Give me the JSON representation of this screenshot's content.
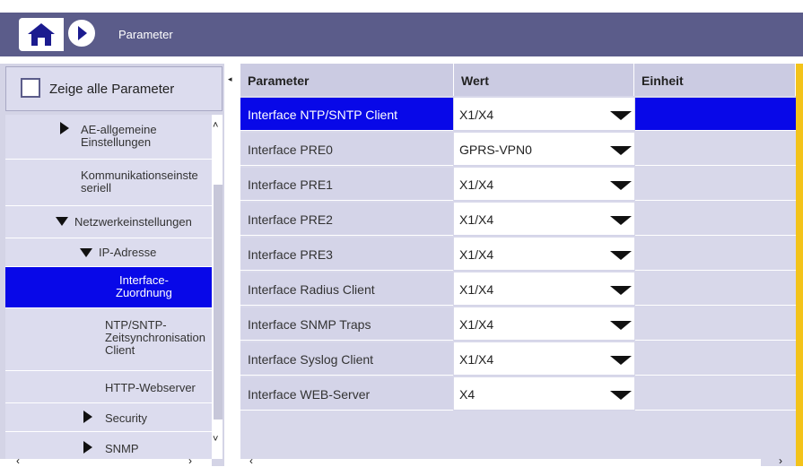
{
  "header": {
    "title": "Parameter",
    "home_icon": "home-icon",
    "forward_icon": "play-icon"
  },
  "left_panel": {
    "show_all_label": "Zeige alle Parameter",
    "show_all_checked": false,
    "tree": [
      {
        "label_lines": [
          "AE-allgemeine",
          "Einstellungen"
        ],
        "icon": "triangle-right-icon"
      },
      {
        "label_lines": [
          "Kommunikationseinste",
          "seriell"
        ],
        "icon": ""
      },
      {
        "label_lines": [
          "Netzwerkeinstellungen"
        ],
        "icon": "triangle-down-icon"
      },
      {
        "label_lines": [
          "IP-Adresse"
        ],
        "icon": "triangle-down-icon"
      },
      {
        "label_lines": [
          "Interface-",
          "Zuordnung"
        ],
        "icon": "",
        "active": true
      },
      {
        "label_lines": [
          "NTP/SNTP-",
          "Zeitsynchronisation",
          "Client"
        ],
        "icon": ""
      },
      {
        "label_lines": [
          "HTTP-Webserver"
        ],
        "icon": ""
      },
      {
        "label_lines": [
          "Security"
        ],
        "icon": "triangle-right-icon"
      },
      {
        "label_lines": [
          "SNMP"
        ],
        "icon": "triangle-right-icon"
      }
    ]
  },
  "table": {
    "columns": [
      "Parameter",
      "Wert",
      "Einheit"
    ],
    "rows": [
      {
        "parameter": "Interface NTP/SNTP Client",
        "value": "X1/X4",
        "unit": "",
        "selected": true
      },
      {
        "parameter": "Interface PRE0",
        "value": "GPRS-VPN0",
        "unit": ""
      },
      {
        "parameter": "Interface PRE1",
        "value": "X1/X4",
        "unit": ""
      },
      {
        "parameter": "Interface PRE2",
        "value": "X1/X4",
        "unit": ""
      },
      {
        "parameter": "Interface PRE3",
        "value": "X1/X4",
        "unit": ""
      },
      {
        "parameter": "Interface Radius Client",
        "value": "X1/X4",
        "unit": ""
      },
      {
        "parameter": "Interface SNMP Traps",
        "value": "X1/X4",
        "unit": ""
      },
      {
        "parameter": "Interface Syslog Client",
        "value": "X1/X4",
        "unit": ""
      },
      {
        "parameter": "Interface WEB-Server",
        "value": "X4",
        "unit": ""
      }
    ]
  },
  "colors": {
    "header_bar": "#5b5c8a",
    "selection": "#0808e8",
    "accent": "#f3c31a"
  }
}
